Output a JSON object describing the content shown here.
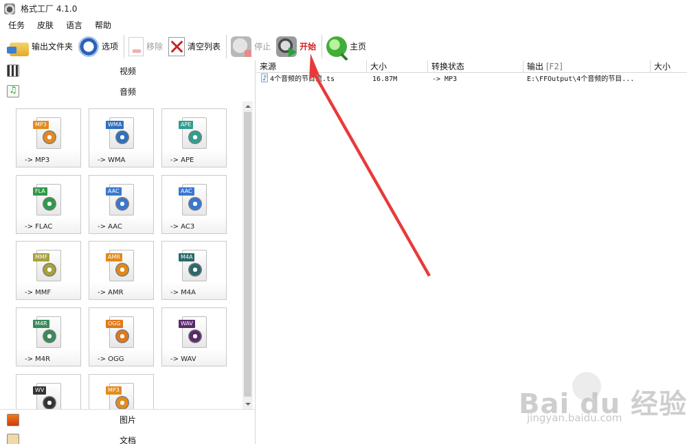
{
  "window": {
    "title": "格式工厂 4.1.0"
  },
  "menu": [
    "任务",
    "皮肤",
    "语言",
    "帮助"
  ],
  "toolbar": {
    "output_folder": "输出文件夹",
    "options": "选项",
    "remove": "移除",
    "clear_list": "清空列表",
    "stop": "停止",
    "start": "开始",
    "home": "主页"
  },
  "categories": {
    "video": "视频",
    "audio": "音频",
    "image": "图片",
    "document": "文档"
  },
  "audio_formats": [
    {
      "badge": "MP3",
      "label": "-> MP3",
      "color": "#e38a1e",
      "icon": "speaker-icon"
    },
    {
      "badge": "WMA",
      "label": "-> WMA",
      "color": "#2f6fbf",
      "icon": "play-icon"
    },
    {
      "badge": "APE",
      "label": "-> APE",
      "color": "#2f9f8f",
      "icon": "speaker-icon"
    },
    {
      "badge": "FLA",
      "label": "-> FLAC",
      "color": "#2f9a4a",
      "icon": "headphones-icon"
    },
    {
      "badge": "AAC",
      "label": "-> AAC",
      "color": "#3a78d0",
      "icon": "music-note-icon"
    },
    {
      "badge": "AAC",
      "label": "-> AC3",
      "color": "#3a78d0",
      "icon": "music-note-icon"
    },
    {
      "badge": "MMF",
      "label": "-> MMF",
      "color": "#a8a23a",
      "icon": "document-icon"
    },
    {
      "badge": "AMR",
      "label": "-> AMR",
      "color": "#e08a1a",
      "icon": "phone-icon"
    },
    {
      "badge": "M4A",
      "label": "-> M4A",
      "color": "#2a6a6a",
      "icon": "music-note-icon"
    },
    {
      "badge": "M4R",
      "label": "-> M4R",
      "color": "#3a8a5a",
      "icon": "phone-icon"
    },
    {
      "badge": "OGG",
      "label": "-> OGG",
      "color": "#e0781a",
      "icon": "music-note-icon"
    },
    {
      "badge": "WAV",
      "label": "-> WAV",
      "color": "#5a2a6a",
      "icon": "music-note-icon"
    },
    {
      "badge": "WV",
      "label": "",
      "color": "#333333",
      "icon": "music-note-icon"
    },
    {
      "badge": "MP3",
      "label": "",
      "color": "#e38a1e",
      "icon": "speaker-icon"
    }
  ],
  "columns": {
    "source": "来源",
    "size": "大小",
    "status": "转换状态",
    "output": "输出",
    "output_shortcut": "[F2]",
    "size2": "大小"
  },
  "tasks": [
    {
      "source": "4个音频的节目流.ts",
      "size": "16.87M",
      "status": "-> MP3",
      "output": "E:\\FFOutput\\4个音频的节目..."
    }
  ],
  "watermark": {
    "logo": "Bai du 经验",
    "url": "jingyan.baidu.com"
  },
  "colors": {
    "start_label": "#d42020",
    "annotation_arrow": "#e83a3a"
  }
}
